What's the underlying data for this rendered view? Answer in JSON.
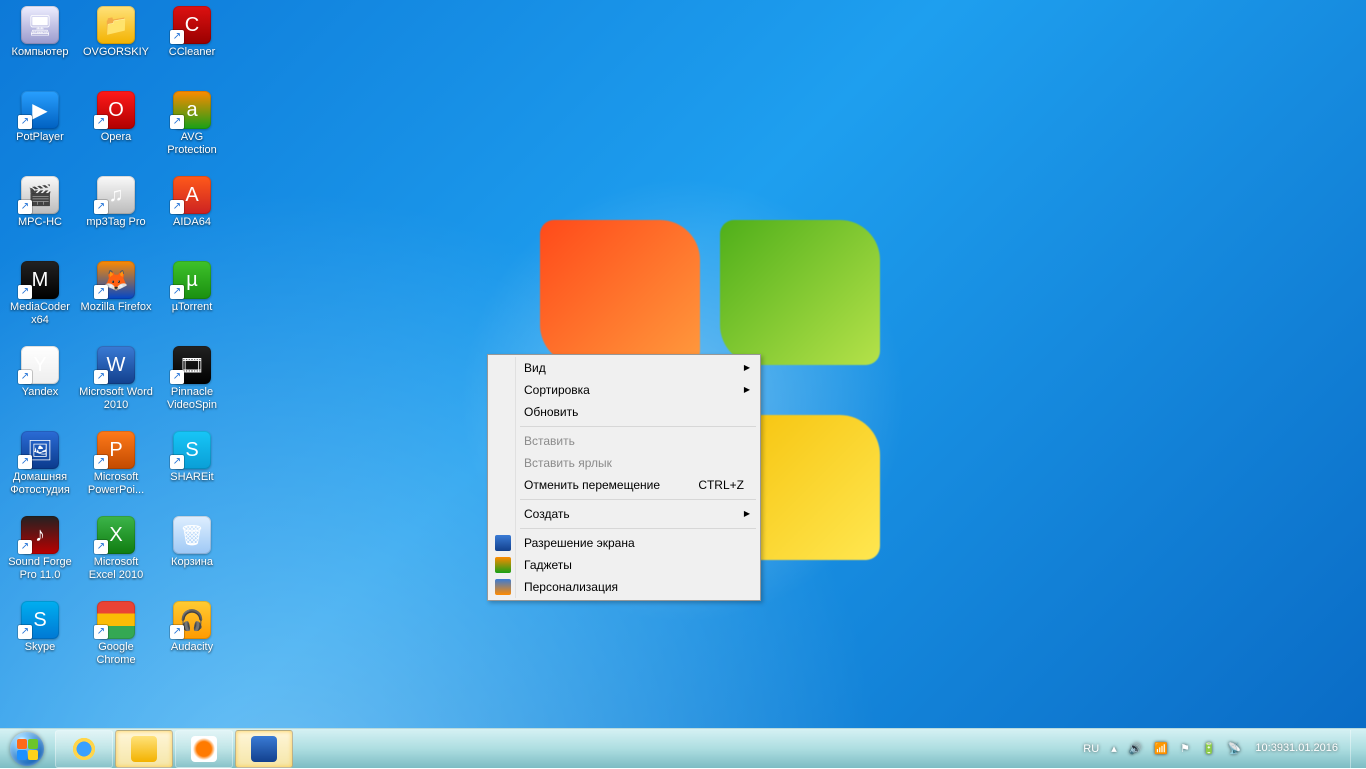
{
  "desktop_icons": [
    {
      "id": "computer",
      "label": "Компьютер",
      "cls": "ic-computer",
      "glyph": "🖥",
      "sc": false
    },
    {
      "id": "ovg",
      "label": "OVGORSKIY",
      "cls": "ic-folder",
      "glyph": "📁",
      "sc": false
    },
    {
      "id": "ccleaner",
      "label": "CCleaner",
      "cls": "ic-ccleaner",
      "glyph": "C",
      "sc": true
    },
    {
      "id": "potplayer",
      "label": "PotPlayer",
      "cls": "ic-pot",
      "glyph": "▶",
      "sc": true
    },
    {
      "id": "opera",
      "label": "Opera",
      "cls": "ic-opera",
      "glyph": "O",
      "sc": true
    },
    {
      "id": "avg",
      "label": "AVG Protection",
      "cls": "ic-avg",
      "glyph": "a",
      "sc": true
    },
    {
      "id": "mpchc",
      "label": "MPC-HC",
      "cls": "ic-mpc",
      "glyph": "🎬",
      "sc": true
    },
    {
      "id": "mp3tag",
      "label": "mp3Tag Pro",
      "cls": "ic-mp3",
      "glyph": "♫",
      "sc": true
    },
    {
      "id": "aida",
      "label": "AIDA64",
      "cls": "ic-aida",
      "glyph": "A",
      "sc": true
    },
    {
      "id": "mediacoder",
      "label": "MediaCoder x64",
      "cls": "ic-mcoder",
      "glyph": "M",
      "sc": true
    },
    {
      "id": "firefox",
      "label": "Mozilla Firefox",
      "cls": "ic-ff",
      "glyph": "🦊",
      "sc": true
    },
    {
      "id": "utorrent",
      "label": "µTorrent",
      "cls": "ic-utor",
      "glyph": "µ",
      "sc": true
    },
    {
      "id": "yandex",
      "label": "Yandex",
      "cls": "ic-yandex",
      "glyph": "Y",
      "sc": true
    },
    {
      "id": "word",
      "label": "Microsoft Word 2010",
      "cls": "ic-word",
      "glyph": "W",
      "sc": true
    },
    {
      "id": "pinnacle",
      "label": "Pinnacle VideoSpin",
      "cls": "ic-pin",
      "glyph": "🎞",
      "sc": true
    },
    {
      "id": "foto",
      "label": "Домашняя Фотостудия",
      "cls": "ic-foto",
      "glyph": "🖼",
      "sc": true
    },
    {
      "id": "ppt",
      "label": "Microsoft PowerPoi...",
      "cls": "ic-ppt",
      "glyph": "P",
      "sc": true
    },
    {
      "id": "shareit",
      "label": "SHAREit",
      "cls": "ic-share",
      "glyph": "S",
      "sc": true
    },
    {
      "id": "sforge",
      "label": "Sound Forge Pro 11.0",
      "cls": "ic-sforge",
      "glyph": "♪",
      "sc": true
    },
    {
      "id": "excel",
      "label": "Microsoft Excel 2010",
      "cls": "ic-excel",
      "glyph": "X",
      "sc": true
    },
    {
      "id": "recycle",
      "label": "Корзина",
      "cls": "ic-bin",
      "glyph": "🗑",
      "sc": false
    },
    {
      "id": "skype",
      "label": "Skype",
      "cls": "ic-skype",
      "glyph": "S",
      "sc": true
    },
    {
      "id": "chrome",
      "label": "Google Chrome",
      "cls": "ic-chrome",
      "glyph": "",
      "sc": true
    },
    {
      "id": "audacity",
      "label": "Audacity",
      "cls": "ic-aud",
      "glyph": "🎧",
      "sc": true
    }
  ],
  "context_menu": {
    "items": [
      {
        "kind": "sub",
        "label": "Вид"
      },
      {
        "kind": "sub",
        "label": "Сортировка"
      },
      {
        "kind": "item",
        "label": "Обновить"
      },
      {
        "kind": "sep"
      },
      {
        "kind": "disabled",
        "label": "Вставить"
      },
      {
        "kind": "disabled",
        "label": "Вставить ярлык"
      },
      {
        "kind": "item",
        "label": "Отменить перемещение",
        "hot": "CTRL+Z"
      },
      {
        "kind": "sep"
      },
      {
        "kind": "sub",
        "label": "Создать"
      },
      {
        "kind": "sep"
      },
      {
        "kind": "item",
        "label": "Разрешение экрана",
        "icon": "mi-res"
      },
      {
        "kind": "item",
        "label": "Гаджеты",
        "icon": "mi-gad"
      },
      {
        "kind": "item",
        "label": "Персонализация",
        "icon": "mi-pers"
      }
    ]
  },
  "taskbar": {
    "buttons": [
      {
        "id": "ie",
        "cls": "tic-ie",
        "active": false
      },
      {
        "id": "explorer",
        "cls": "tic-exp",
        "active": true
      },
      {
        "id": "wmp",
        "cls": "tic-wmp",
        "active": false
      },
      {
        "id": "word",
        "cls": "tic-word",
        "active": true
      }
    ],
    "tray": {
      "lang": "RU",
      "time": "10:39",
      "date": "31.01.2016"
    }
  }
}
